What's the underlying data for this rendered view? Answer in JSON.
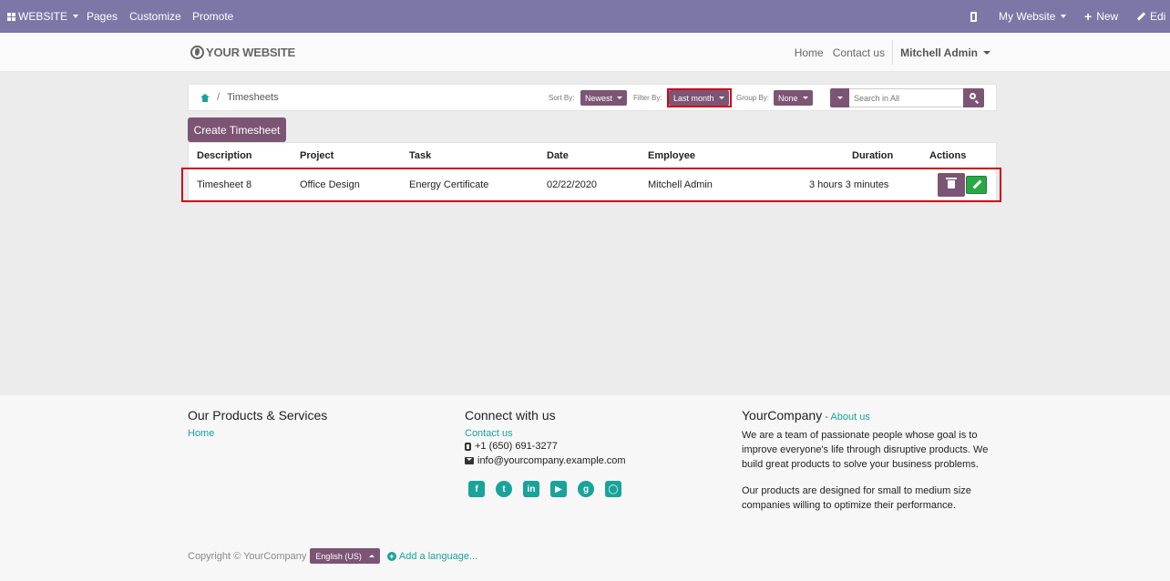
{
  "admin_bar": {
    "website": "WEBSITE",
    "pages": "Pages",
    "customize": "Customize",
    "promote": "Promote",
    "my_website": "My Website",
    "new": "New",
    "edit": "Edi"
  },
  "header": {
    "logo": "YOUR WEBSITE",
    "home": "Home",
    "contact": "Contact us",
    "user": "Mitchell Admin"
  },
  "breadcrumb": {
    "current": "Timesheets"
  },
  "filters": {
    "sort_label": "Sort By:",
    "sort_value": "Newest",
    "filter_label": "Filter By:",
    "filter_value": "Last month",
    "group_label": "Group By:",
    "group_value": "None",
    "search_placeholder": "Search in All"
  },
  "create_button": "Create Timesheet",
  "table": {
    "headers": [
      "Description",
      "Project",
      "Task",
      "Date",
      "Employee",
      "Duration",
      "Actions"
    ],
    "rows": [
      {
        "description": "Timesheet 8",
        "project": "Office Design",
        "task": "Energy Certificate",
        "date": "02/22/2020",
        "employee": "Mitchell Admin",
        "duration": "3 hours 3 minutes"
      }
    ]
  },
  "footer": {
    "col1_title": "Our Products & Services",
    "col1_link": "Home",
    "col2_title": "Connect with us",
    "col2_link": "Contact us",
    "phone": "+1 (650) 691-3277",
    "email": "info@yourcompany.example.com",
    "col3_title": "YourCompany",
    "col3_sep": " - ",
    "col3_link": "About us",
    "para1": "We are a team of passionate people whose goal is to improve everyone's life through disruptive products. We build great products to solve your business problems.",
    "para2": "Our products are designed for small to medium size companies willing to optimize their performance.",
    "copyright": "Copyright © YourCompany",
    "language": "English (US)",
    "add_language": "Add a language..."
  },
  "colors": {
    "admin_bar": "#7b78a8",
    "primary": "#7c5574",
    "link": "#1aa39a",
    "highlight": "#d0021b",
    "edit_button": "#28a745"
  },
  "icons": [
    "apps-icon",
    "mobile-icon",
    "plus-icon",
    "pencil-icon",
    "globe-icon",
    "home-icon",
    "search-icon",
    "trash-icon",
    "phone-icon",
    "envelope-icon",
    "facebook-icon",
    "twitter-icon",
    "linkedin-icon",
    "youtube-icon",
    "github-icon",
    "instagram-icon"
  ]
}
